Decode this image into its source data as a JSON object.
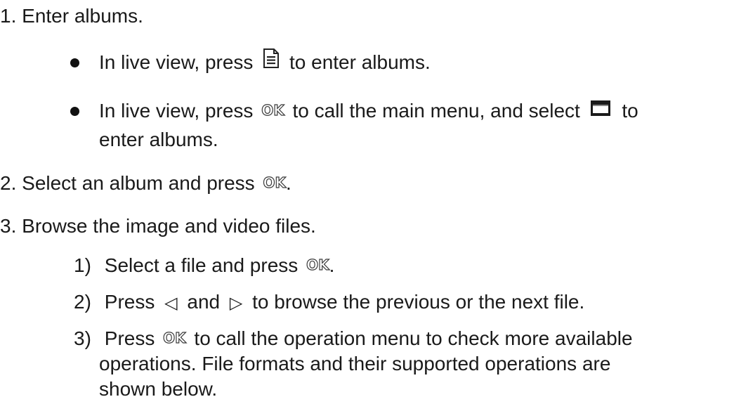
{
  "steps": [
    {
      "num": "1.",
      "text": "Enter albums."
    },
    {
      "num": "2.",
      "text_before": "Select an album and press",
      "text_after": "."
    },
    {
      "num": "3.",
      "text": "Browse the image and video files."
    }
  ],
  "bullets": [
    {
      "before": "In live view, press",
      "after": "to enter albums.",
      "icon": "album-file-icon"
    },
    {
      "before": "In live view, press",
      "middle": "to call the main menu, and select",
      "after": "to",
      "cont": "enter albums.",
      "icons": [
        "ok-button-icon",
        "folder-icon"
      ]
    }
  ],
  "substeps": [
    {
      "num": "1)",
      "before": "Select a file and press",
      "after": "."
    },
    {
      "num": "2)",
      "before": "Press",
      "middle": "and",
      "after": "to browse the previous or the next file."
    },
    {
      "num": "3)",
      "before": "Press",
      "after": "to call the operation menu to check more available",
      "line2": "operations. File formats and their supported operations are",
      "line3": "shown below."
    }
  ],
  "ok_glyph": "OK",
  "left_arrow_glyph": "◁",
  "right_arrow_glyph": "▷"
}
